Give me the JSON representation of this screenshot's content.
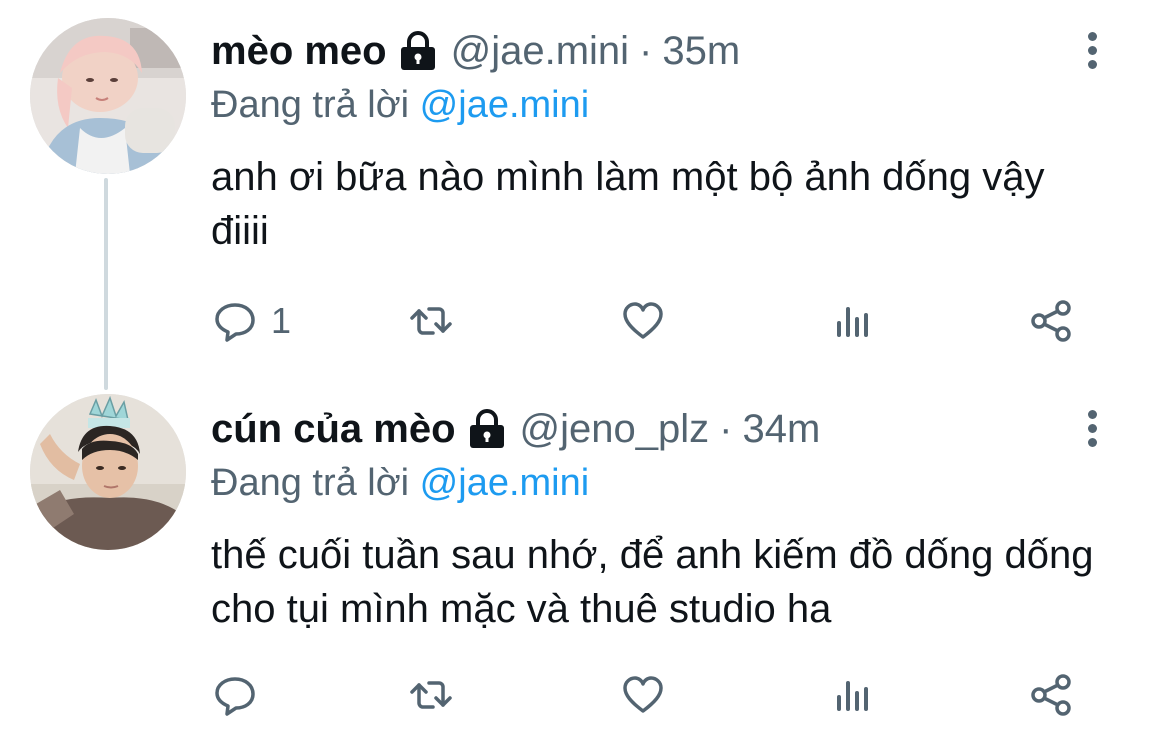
{
  "tweets": [
    {
      "display_name": "mèo meo",
      "handle": "@jae.mini",
      "separator": "·",
      "time": "35m",
      "reply_prefix": "Đang trả lời",
      "reply_to": "@jae.mini",
      "text": "anh ơi bữa nào mình làm một bộ ảnh dống vậy điiii",
      "reply_count": "1",
      "avatar": "avatar-pink-hair-person"
    },
    {
      "display_name": "cún của mèo",
      "handle": "@jeno_plz",
      "separator": "·",
      "time": "34m",
      "reply_prefix": "Đang trả lời",
      "reply_to": "@jae.mini",
      "text": "thế cuối tuần sau nhớ, để anh kiếm đồ dống dống cho tụi mình mặc và thuê studio ha",
      "reply_count": "",
      "avatar": "avatar-person-with-crown"
    }
  ],
  "icons": {
    "lock": "lock-icon",
    "more": "more-vertical-icon",
    "reply": "reply-icon",
    "retweet": "retweet-icon",
    "like": "heart-icon",
    "views": "views-chart-icon",
    "share": "share-icon"
  },
  "colors": {
    "text": "#0f1419",
    "secondary": "#536471",
    "mention": "#1d9bf0",
    "thread_line": "#cfd9de"
  }
}
